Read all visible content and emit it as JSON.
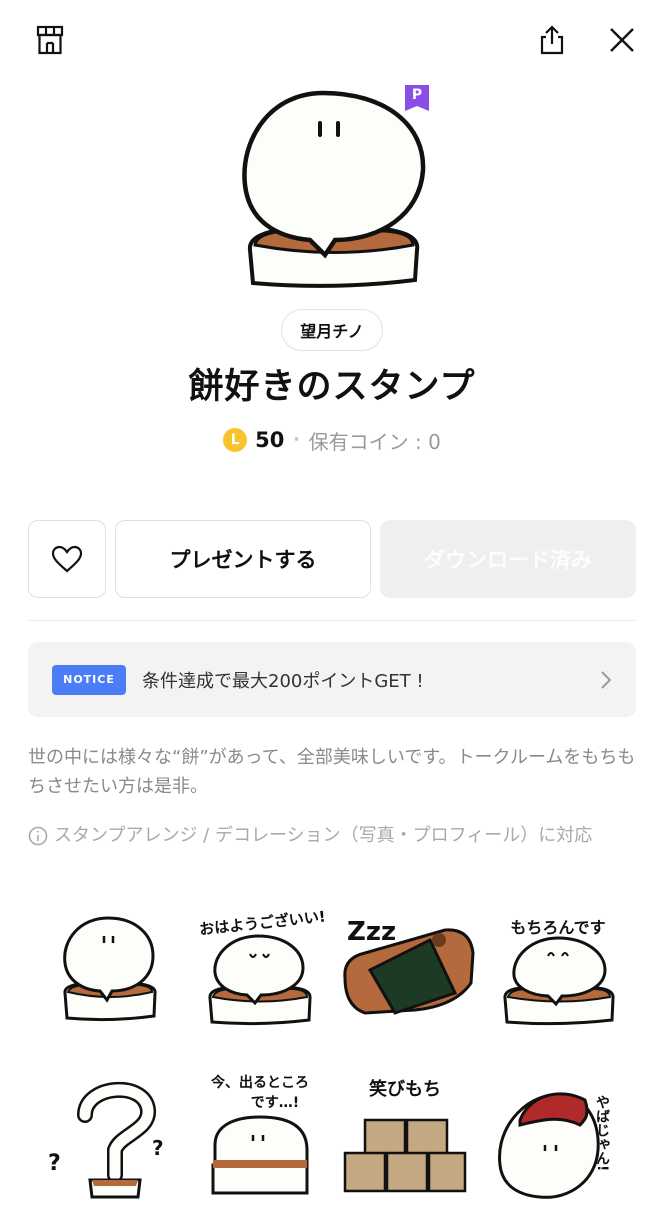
{
  "product": {
    "author": "望月チノ",
    "title": "餅好きのスタンプ",
    "coin_letter": "L",
    "price": "50",
    "separator": "•",
    "owned_coins": "保有コイン : 0",
    "premium_badge": "P"
  },
  "actions": {
    "gift_label": "プレゼントする",
    "download_label": "ダウンロード済み"
  },
  "notice": {
    "badge": "NOTICE",
    "text": "条件達成で最大200ポイントGET !"
  },
  "description": "世の中には様々な“餅”があって、全部美味しいです。トークルームをもちもちさせたい方は是非。",
  "arrange_note": "スタンプアレンジ / デコレーション（写真・プロフィール）に対応",
  "stickers": {
    "s2_text": "おはようございい!",
    "s3_text": "Zzz",
    "s4_text": "もちろんです",
    "s6_text_1": "今、出るところ",
    "s6_text_2": "です…!",
    "s7_text": "笑びもち",
    "s8_text": "やばじゃん!"
  },
  "colors": {
    "accent_blue": "#4d7cf7",
    "coin_yellow": "#f7c52b",
    "premium_purple": "#8a4ee8",
    "mochi_brown": "#b46a3c"
  },
  "icons": [
    "shop-icon",
    "share-icon",
    "close-icon",
    "heart-icon",
    "chevron-right-icon",
    "info-icon"
  ]
}
